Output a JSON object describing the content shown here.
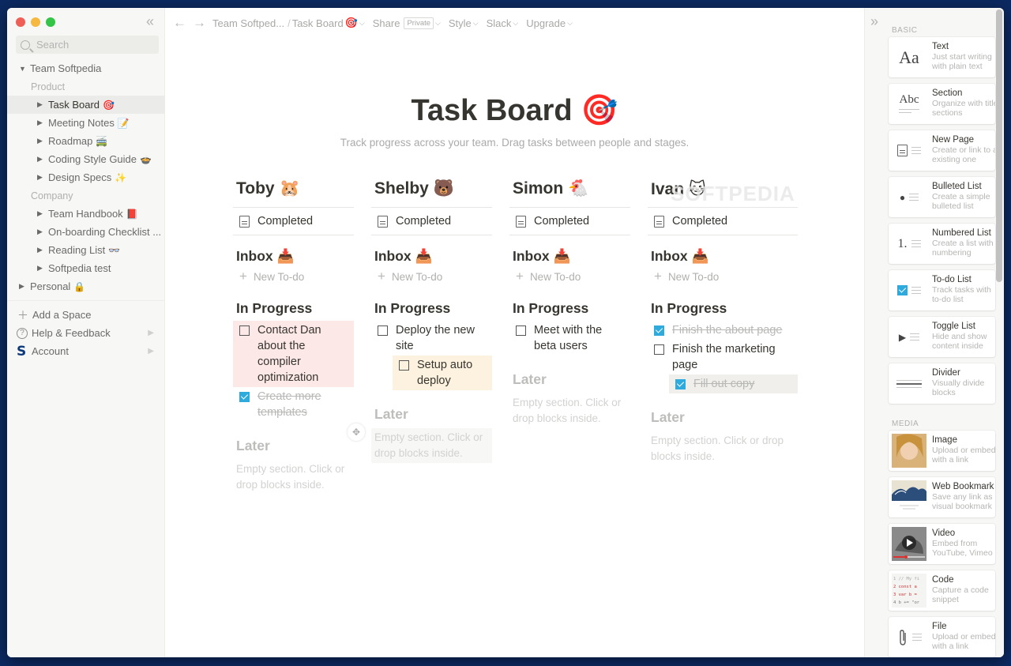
{
  "window": {
    "title": "Task Board"
  },
  "sidebar": {
    "search_placeholder": "Search",
    "workspace": "Team Softpedia",
    "groups": [
      {
        "label": "Product",
        "items": [
          {
            "label": "Task Board",
            "emoji": "🎯",
            "active": true
          },
          {
            "label": "Meeting Notes",
            "emoji": "📝"
          },
          {
            "label": "Roadmap",
            "emoji": "🚎"
          },
          {
            "label": "Coding Style Guide",
            "emoji": "🍲"
          },
          {
            "label": "Design Specs",
            "emoji": "✨"
          }
        ]
      },
      {
        "label": "Company",
        "items": [
          {
            "label": "Team Handbook",
            "emoji": "📕"
          },
          {
            "label": "On-boarding Checklist ...",
            "emoji": ""
          },
          {
            "label": "Reading List",
            "emoji": "👓"
          },
          {
            "label": "Softpedia test",
            "emoji": ""
          }
        ]
      }
    ],
    "personal": {
      "label": "Personal",
      "emoji": "🔒"
    },
    "footer": {
      "add_space": "Add a Space",
      "help": "Help & Feedback",
      "account": "Account"
    }
  },
  "topbar": {
    "breadcrumb_parent": "Team Softped...",
    "breadcrumb_sep": "/",
    "breadcrumb_current": "Task Board",
    "breadcrumb_emoji": "🎯",
    "share": "Share",
    "privacy_badge": "Private",
    "style": "Style",
    "slack": "Slack",
    "upgrade": "Upgrade"
  },
  "page": {
    "title": "Task Board",
    "title_emoji": "🎯",
    "subtitle": "Track progress across your team.  Drag tasks between people and stages."
  },
  "board": {
    "completed_label": "Completed",
    "inbox_label": "Inbox",
    "inbox_emoji": "📥",
    "new_todo": "New To-do",
    "in_progress_label": "In Progress",
    "later_label": "Later",
    "empty_text": "Empty section. Click or drop blocks inside.",
    "columns": [
      {
        "name": "Toby",
        "emoji": "🐹",
        "in_progress": [
          {
            "text": "Contact Dan about the compiler optimization",
            "checked": false,
            "highlight": "pink"
          },
          {
            "text": "Create more templates",
            "checked": true
          }
        ]
      },
      {
        "name": "Shelby",
        "emoji": "🐻",
        "in_progress": [
          {
            "text": "Deploy the new site",
            "checked": false
          },
          {
            "text": "Setup auto deploy",
            "checked": false,
            "highlight": "orange",
            "indent": true
          }
        ]
      },
      {
        "name": "Simon",
        "emoji": "🐔",
        "in_progress": [
          {
            "text": "Meet with the beta users",
            "checked": false
          }
        ]
      },
      {
        "name": "Ivan",
        "emoji": "🐱",
        "in_progress": [
          {
            "text": "Finish the about page",
            "checked": true
          },
          {
            "text": "Finish the marketing page",
            "checked": false
          },
          {
            "text": "Fill out copy",
            "checked": true,
            "highlight": "gray",
            "indent": true
          }
        ]
      }
    ]
  },
  "watermark": "SOFTPEDIA",
  "right_panel": {
    "basic_label": "BASIC",
    "media_label": "MEDIA",
    "basic_blocks": [
      {
        "name": "Text",
        "desc": "Just start writing with plain text",
        "icon": "text-icon"
      },
      {
        "name": "Section",
        "desc": "Organize with titled sections",
        "icon": "section-icon"
      },
      {
        "name": "New Page",
        "desc": "Create or link to an existing one",
        "icon": "page-icon"
      },
      {
        "name": "Bulleted List",
        "desc": "Create a simple bulleted list",
        "icon": "bullet-icon"
      },
      {
        "name": "Numbered List",
        "desc": "Create a list with numbering",
        "icon": "numbered-icon"
      },
      {
        "name": "To-do List",
        "desc": "Track tasks with to-do list",
        "icon": "todo-icon"
      },
      {
        "name": "Toggle List",
        "desc": "Hide and show content inside",
        "icon": "toggle-icon"
      },
      {
        "name": "Divider",
        "desc": "Visually divide blocks",
        "icon": "divider-icon"
      }
    ],
    "media_blocks": [
      {
        "name": "Image",
        "desc": "Upload or embed with a link",
        "icon": "image-icon"
      },
      {
        "name": "Web Bookmark",
        "desc": "Save any link as visual bookmark",
        "icon": "bookmark-icon"
      },
      {
        "name": "Video",
        "desc": "Embed from YouTube, Vimeo",
        "icon": "video-icon"
      },
      {
        "name": "Code",
        "desc": "Capture a code snippet",
        "icon": "code-icon"
      },
      {
        "name": "File",
        "desc": "Upload or embed with a link",
        "icon": "file-icon"
      }
    ],
    "text_icon_glyph": "Aa",
    "section_icon_glyph": "Abc",
    "numbered_icon_glyph": "1."
  },
  "colors": {
    "accent_checkbox": "#2eaadc",
    "highlight_pink": "#fde8e8",
    "highlight_orange": "#fdf1df",
    "highlight_gray": "#f0efec",
    "desktop_bg": "#0c2a62"
  }
}
